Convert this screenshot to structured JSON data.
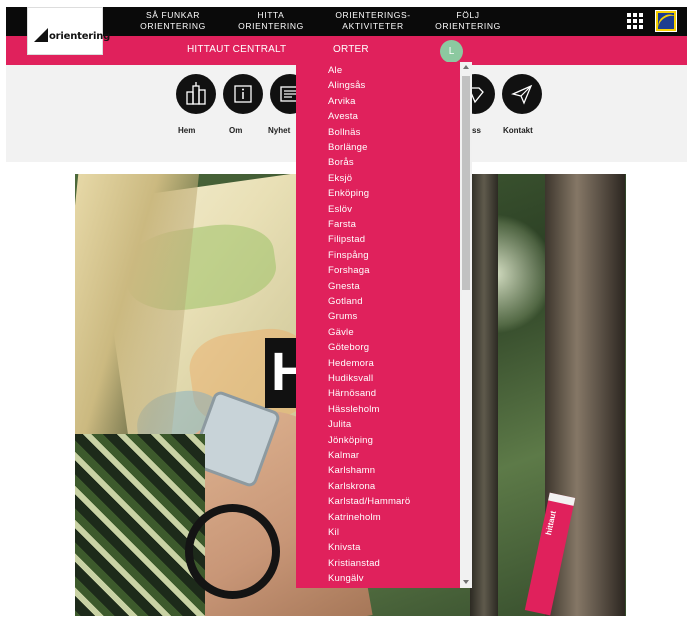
{
  "logo": {
    "text": "orientering"
  },
  "nav": {
    "items": [
      {
        "line1": "SÅ FUNKAR",
        "line2": "ORIENTERING"
      },
      {
        "line1": "HITTA",
        "line2": "ORIENTERING"
      },
      {
        "line1": "ORIENTERINGS-",
        "line2": "AKTIVITETER"
      },
      {
        "line1": "FÖLJ",
        "line2": "ORIENTERING"
      }
    ]
  },
  "subnav": {
    "items": [
      {
        "label": "HITTAUT CENTRALT"
      },
      {
        "label": "ORTER"
      }
    ],
    "avatar_letter": "L"
  },
  "icon_row": {
    "items": [
      {
        "label": "Hem"
      },
      {
        "label": "Om"
      },
      {
        "label": "Nyhet"
      },
      {
        "label": "ss"
      },
      {
        "label": "Kontakt"
      }
    ]
  },
  "hero": {
    "title_fragment": "H",
    "tag_text": "hittaut"
  },
  "dropdown": {
    "towns": [
      "Ale",
      "Alingsås",
      "Arvika",
      "Avesta",
      "Bollnäs",
      "Borlänge",
      "Borås",
      "Eksjö",
      "Enköping",
      "Eslöv",
      "Farsta",
      "Filipstad",
      "Finspång",
      "Forshaga",
      "Gnesta",
      "Gotland",
      "Grums",
      "Gävle",
      "Göteborg",
      "Hedemora",
      "Hudiksvall",
      "Härnösand",
      "Hässleholm",
      "Julita",
      "Jönköping",
      "Kalmar",
      "Karlshamn",
      "Karlskrona",
      "Karlstad/Hammarö",
      "Katrineholm",
      "Kil",
      "Knivsta",
      "Kristianstad",
      "Kungälv"
    ]
  },
  "colors": {
    "brand_pink": "#e0215c",
    "topbar": "#0a0a0a",
    "icon_bg": "#f2f2f2"
  }
}
